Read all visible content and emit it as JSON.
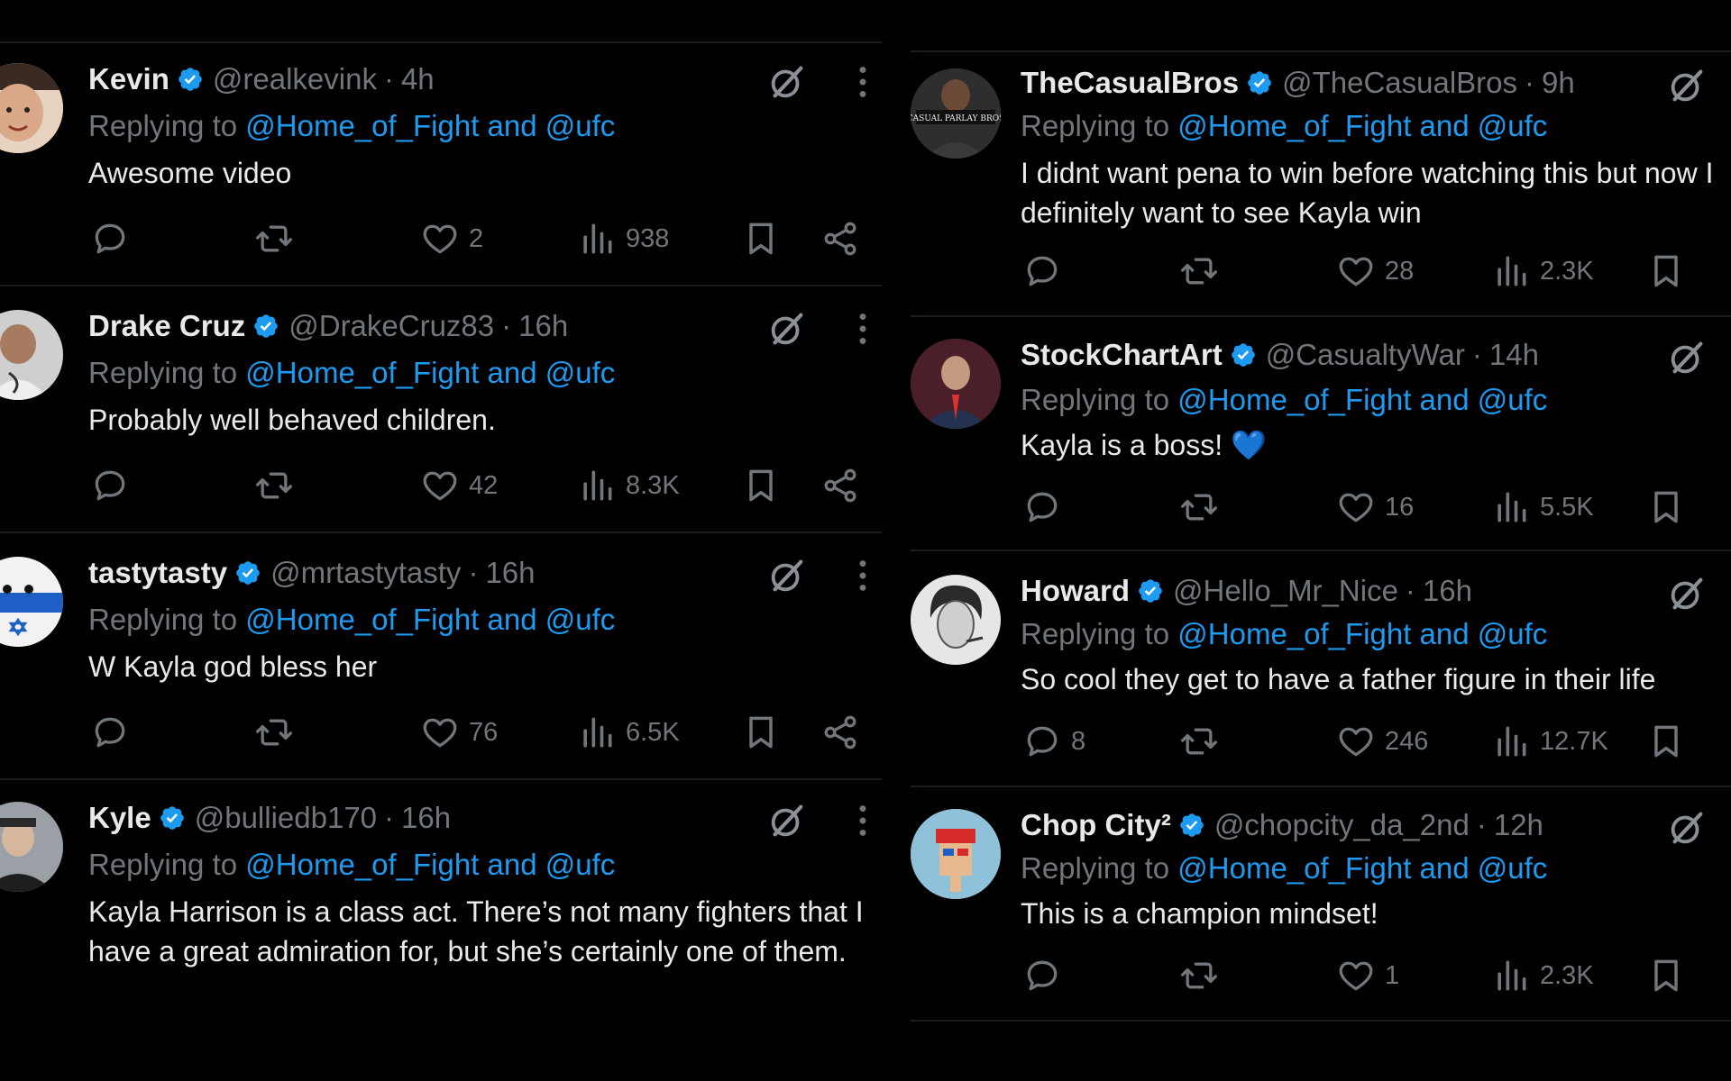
{
  "columns": [
    {
      "tweets": [
        {
          "name": "Kevin",
          "handle": "@realkevink",
          "time": "4h",
          "replying_prefix": "Replying to ",
          "replying_mentions": "@Home_of_Fight and @ufc",
          "text": "Awesome video",
          "reply_count": "",
          "like_count": "2",
          "view_count": "938",
          "avatar_color": "#c9a58a"
        },
        {
          "name": "Drake Cruz",
          "handle": "@DrakeCruz83",
          "time": "16h",
          "replying_prefix": "Replying to ",
          "replying_mentions": "@Home_of_Fight and @ufc",
          "text": "Probably well behaved children.",
          "reply_count": "",
          "like_count": "42",
          "view_count": "8.3K",
          "avatar_color": "#d9d9d9"
        },
        {
          "name": "tastytasty",
          "handle": "@mrtastytasty",
          "time": "16h",
          "replying_prefix": "Replying to ",
          "replying_mentions": "@Home_of_Fight and @ufc",
          "text": "W Kayla god bless her",
          "reply_count": "",
          "like_count": "76",
          "view_count": "6.5K",
          "avatar_color": "#eaeaea"
        },
        {
          "name": "Kyle",
          "handle": "@bulliedb170",
          "time": "16h",
          "replying_prefix": "Replying to ",
          "replying_mentions": "@Home_of_Fight and @ufc",
          "text": "Kayla Harrison is a class act. There’s not many fighters that I have a great admiration for, but she’s certainly one of them.",
          "reply_count": "",
          "like_count": "",
          "view_count": "",
          "avatar_color": "#8a8f96"
        }
      ]
    },
    {
      "tweets": [
        {
          "name": "TheCasualBros",
          "handle": "@TheCasualBros",
          "time": "9h",
          "replying_prefix": "Replying to ",
          "replying_mentions": "@Home_of_Fight and @ufc",
          "text": "I didnt want pena to win before watching this but now I definitely want to see Kayla win",
          "reply_count": "",
          "like_count": "28",
          "view_count": "2.3K",
          "avatar_color": "#2e2e2e",
          "avatar_text": "CASUAL PARLAY BROS"
        },
        {
          "name": "StockChartArt",
          "handle": "@CasualtyWar",
          "time": "14h",
          "replying_prefix": "Replying to ",
          "replying_mentions": "@Home_of_Fight and @ufc",
          "text": "Kayla is a boss! 💙",
          "reply_count": "",
          "like_count": "16",
          "view_count": "5.5K",
          "avatar_color": "#2b3a6b"
        },
        {
          "name": "Howard",
          "handle": "@Hello_Mr_Nice",
          "time": "16h",
          "replying_prefix": "Replying to ",
          "replying_mentions": "@Home_of_Fight and @ufc",
          "text": "So cool they get to have a father figure in their life",
          "reply_count": "8",
          "like_count": "246",
          "view_count": "12.7K",
          "avatar_color": "#d8d8d8"
        },
        {
          "name": "Chop City²",
          "handle": "@chopcity_da_2nd",
          "time": "12h",
          "replying_prefix": "Replying to ",
          "replying_mentions": "@Home_of_Fight and @ufc",
          "text": "This is a champion mindset!",
          "reply_count": "",
          "like_count": "1",
          "view_count": "2.3K",
          "avatar_color": "#7fb7d1"
        }
      ]
    }
  ],
  "icons": {
    "verified": "verified-badge-icon",
    "grok": "grok-icon",
    "more": "more-icon",
    "reply": "reply-icon",
    "retweet": "retweet-icon",
    "like": "heart-icon",
    "views": "views-icon",
    "bookmark": "bookmark-icon",
    "share": "share-icon"
  },
  "colors": {
    "background": "#000000",
    "text": "#e7e9ea",
    "muted": "#71767b",
    "accent": "#1d9bf0"
  }
}
